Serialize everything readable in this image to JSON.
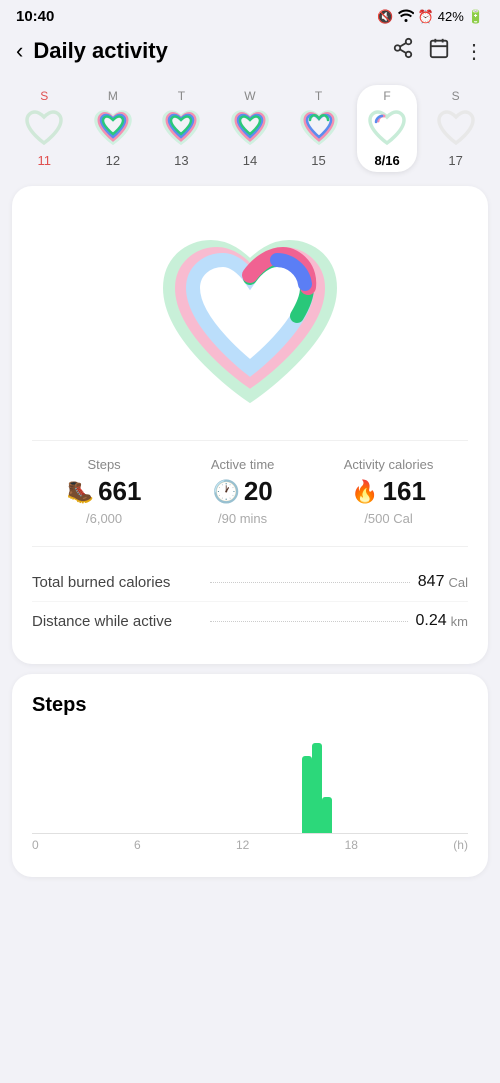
{
  "statusBar": {
    "time": "10:40",
    "battery": "42%",
    "icons": [
      "🔕",
      "📶",
      "⏰"
    ]
  },
  "header": {
    "backIcon": "‹",
    "title": "Daily activity",
    "shareIcon": "share",
    "calendarIcon": "calendar",
    "moreIcon": "more"
  },
  "calendar": {
    "days": [
      {
        "name": "S",
        "date": "11",
        "type": "sunday",
        "active": false,
        "heartLevel": "empty"
      },
      {
        "name": "M",
        "date": "12",
        "type": "weekday",
        "active": false,
        "heartLevel": "full"
      },
      {
        "name": "T",
        "date": "13",
        "type": "weekday",
        "active": false,
        "heartLevel": "full"
      },
      {
        "name": "W",
        "date": "14",
        "type": "weekday",
        "active": false,
        "heartLevel": "full"
      },
      {
        "name": "T",
        "date": "15",
        "type": "weekday",
        "active": false,
        "heartLevel": "partial"
      },
      {
        "name": "F",
        "date": "8/16",
        "type": "weekday",
        "active": true,
        "heartLevel": "low"
      },
      {
        "name": "S",
        "date": "17",
        "type": "saturday",
        "active": false,
        "heartLevel": "none"
      }
    ]
  },
  "mainCard": {
    "stats": [
      {
        "label": "Steps",
        "value": "661",
        "icon": "🥾",
        "iconColor": "#2cd87a",
        "goal": "/6,000"
      },
      {
        "label": "Active time",
        "value": "20",
        "icon": "🕐",
        "iconColor": "#5b7ef5",
        "goal": "/90 mins"
      },
      {
        "label": "Activity calories",
        "value": "161",
        "icon": "🔥",
        "iconColor": "#f06292",
        "goal": "/500 Cal"
      }
    ],
    "infoRows": [
      {
        "label": "Total burned calories",
        "value": "847",
        "unit": "Cal"
      },
      {
        "label": "Distance while active",
        "value": "0.24",
        "unit": "km"
      }
    ]
  },
  "stepsCard": {
    "title": "Steps",
    "chartBars": [
      0,
      0,
      0,
      0,
      0,
      0,
      0,
      0,
      0,
      0,
      0,
      0,
      0,
      0,
      0,
      0,
      0,
      0,
      0,
      0,
      0,
      0,
      0,
      0,
      0,
      0,
      0,
      0,
      0,
      0,
      85,
      100,
      40,
      0,
      0,
      0,
      0,
      0,
      0,
      0,
      0,
      0,
      0,
      0,
      0,
      0,
      0,
      0
    ],
    "xLabels": [
      "0",
      "6",
      "12",
      "18",
      "(h)"
    ]
  }
}
